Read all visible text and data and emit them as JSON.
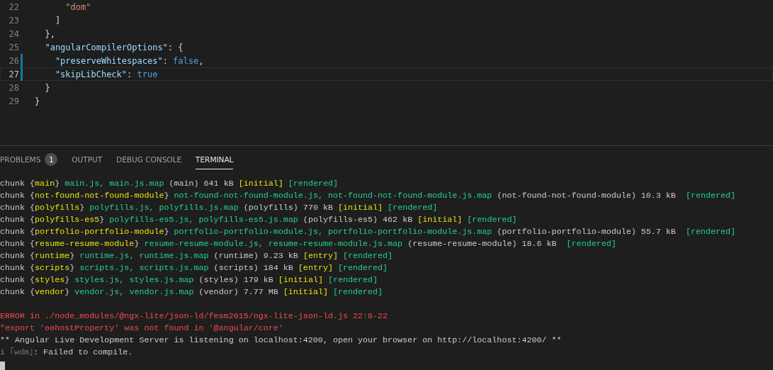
{
  "editor": {
    "lines": [
      {
        "number": "22",
        "current": false,
        "modified": false,
        "tokens": [
          {
            "kind": "string",
            "text": "      \"dom\""
          }
        ]
      },
      {
        "number": "23",
        "current": false,
        "modified": false,
        "tokens": [
          {
            "kind": "punct",
            "text": "    ]"
          }
        ]
      },
      {
        "number": "24",
        "current": false,
        "modified": false,
        "tokens": [
          {
            "kind": "punct",
            "text": "  },"
          }
        ]
      },
      {
        "number": "25",
        "current": false,
        "modified": false,
        "tokens": [
          {
            "kind": "key",
            "text": "  \"angularCompilerOptions\""
          },
          {
            "kind": "punct",
            "text": ": {"
          }
        ]
      },
      {
        "number": "26",
        "current": false,
        "modified": true,
        "tokens": [
          {
            "kind": "key",
            "text": "    \"preserveWhitespaces\""
          },
          {
            "kind": "punct",
            "text": ": "
          },
          {
            "kind": "keyword",
            "text": "false"
          },
          {
            "kind": "punct",
            "text": ","
          }
        ]
      },
      {
        "number": "27",
        "current": true,
        "modified": true,
        "tokens": [
          {
            "kind": "key",
            "text": "    \"skipLibCheck\""
          },
          {
            "kind": "punct",
            "text": ": "
          },
          {
            "kind": "keyword",
            "text": "true"
          }
        ]
      },
      {
        "number": "28",
        "current": false,
        "modified": false,
        "tokens": [
          {
            "kind": "punct",
            "text": "  }"
          }
        ]
      },
      {
        "number": "29",
        "current": false,
        "modified": false,
        "tokens": [
          {
            "kind": "punct",
            "text": "}"
          }
        ]
      }
    ]
  },
  "panel": {
    "tabs": [
      {
        "label": "PROBLEMS",
        "badge": "1",
        "selected": false
      },
      {
        "label": "OUTPUT",
        "selected": false
      },
      {
        "label": "DEBUG CONSOLE",
        "selected": false
      },
      {
        "label": "TERMINAL",
        "selected": true
      }
    ],
    "terminal": {
      "blocks": [
        {
          "lines": [
            [
              {
                "kind": "text",
                "text": "chunk "
              },
              {
                "kind": "text",
                "text": "{"
              },
              {
                "kind": "name",
                "text": "main"
              },
              {
                "kind": "text",
                "text": "}"
              },
              {
                "kind": "file",
                "text": " main.js, main.js.map"
              },
              {
                "kind": "text",
                "text": " (main) 641 kB "
              },
              {
                "kind": "name",
                "text": "[initial]"
              },
              {
                "kind": "file",
                "text": " [rendered]"
              }
            ],
            [
              {
                "kind": "text",
                "text": "chunk "
              },
              {
                "kind": "text",
                "text": "{"
              },
              {
                "kind": "name",
                "text": "not-found-not-found-module"
              },
              {
                "kind": "text",
                "text": "}"
              },
              {
                "kind": "file",
                "text": " not-found-not-found-module.js, not-found-not-found-module.js.map"
              },
              {
                "kind": "text",
                "text": " (not-found-not-found-module) 10.3 kB  "
              },
              {
                "kind": "file",
                "text": "[rendered]"
              }
            ],
            [
              {
                "kind": "text",
                "text": "chunk "
              },
              {
                "kind": "text",
                "text": "{"
              },
              {
                "kind": "name",
                "text": "polyfills"
              },
              {
                "kind": "text",
                "text": "}"
              },
              {
                "kind": "file",
                "text": " polyfills.js, polyfills.js.map"
              },
              {
                "kind": "text",
                "text": " (polyfills) 770 kB "
              },
              {
                "kind": "name",
                "text": "[initial]"
              },
              {
                "kind": "file",
                "text": " [rendered]"
              }
            ],
            [
              {
                "kind": "text",
                "text": "chunk "
              },
              {
                "kind": "text",
                "text": "{"
              },
              {
                "kind": "name",
                "text": "polyfills-es5"
              },
              {
                "kind": "text",
                "text": "}"
              },
              {
                "kind": "file",
                "text": " polyfills-es5.js, polyfills-es5.js.map"
              },
              {
                "kind": "text",
                "text": " (polyfills-es5) 462 kB "
              },
              {
                "kind": "name",
                "text": "[initial]"
              },
              {
                "kind": "file",
                "text": " [rendered]"
              }
            ],
            [
              {
                "kind": "text",
                "text": "chunk "
              },
              {
                "kind": "text",
                "text": "{"
              },
              {
                "kind": "name",
                "text": "portfolio-portfolio-module"
              },
              {
                "kind": "text",
                "text": "}"
              },
              {
                "kind": "file",
                "text": " portfolio-portfolio-module.js, portfolio-portfolio-module.js.map"
              },
              {
                "kind": "text",
                "text": " (portfolio-portfolio-module) 55.7 kB  "
              },
              {
                "kind": "file",
                "text": "[rendered]"
              }
            ],
            [
              {
                "kind": "text",
                "text": "chunk "
              },
              {
                "kind": "text",
                "text": "{"
              },
              {
                "kind": "name",
                "text": "resume-resume-module"
              },
              {
                "kind": "text",
                "text": "}"
              },
              {
                "kind": "file",
                "text": " resume-resume-module.js, resume-resume-module.js.map"
              },
              {
                "kind": "text",
                "text": " (resume-resume-module) 18.6 kB  "
              },
              {
                "kind": "file",
                "text": "[rendered]"
              }
            ],
            [
              {
                "kind": "text",
                "text": "chunk "
              },
              {
                "kind": "text",
                "text": "{"
              },
              {
                "kind": "name",
                "text": "runtime"
              },
              {
                "kind": "text",
                "text": "}"
              },
              {
                "kind": "file",
                "text": " runtime.js, runtime.js.map"
              },
              {
                "kind": "text",
                "text": " (runtime) 9.23 kB "
              },
              {
                "kind": "name",
                "text": "[entry]"
              },
              {
                "kind": "file",
                "text": " [rendered]"
              }
            ],
            [
              {
                "kind": "text",
                "text": "chunk "
              },
              {
                "kind": "text",
                "text": "{"
              },
              {
                "kind": "name",
                "text": "scripts"
              },
              {
                "kind": "text",
                "text": "}"
              },
              {
                "kind": "file",
                "text": " scripts.js, scripts.js.map"
              },
              {
                "kind": "text",
                "text": " (scripts) 184 kB "
              },
              {
                "kind": "name",
                "text": "[entry]"
              },
              {
                "kind": "file",
                "text": " [rendered]"
              }
            ],
            [
              {
                "kind": "text",
                "text": "chunk "
              },
              {
                "kind": "text",
                "text": "{"
              },
              {
                "kind": "name",
                "text": "styles"
              },
              {
                "kind": "text",
                "text": "}"
              },
              {
                "kind": "file",
                "text": " styles.js, styles.js.map"
              },
              {
                "kind": "text",
                "text": " (styles) 179 kB "
              },
              {
                "kind": "name",
                "text": "[initial]"
              },
              {
                "kind": "file",
                "text": " [rendered]"
              }
            ],
            [
              {
                "kind": "text",
                "text": "chunk "
              },
              {
                "kind": "text",
                "text": "{"
              },
              {
                "kind": "name",
                "text": "vendor"
              },
              {
                "kind": "text",
                "text": "}"
              },
              {
                "kind": "file",
                "text": " vendor.js, vendor.js.map"
              },
              {
                "kind": "text",
                "text": " (vendor) 7.77 MB "
              },
              {
                "kind": "name",
                "text": "[initial]"
              },
              {
                "kind": "file",
                "text": " [rendered]"
              }
            ]
          ]
        },
        {
          "lines": [
            [
              {
                "kind": "error",
                "text": "ERROR in ./node_modules/@ngx-lite/json-ld/fesm2015/ngx-lite-json-ld.js 22:8-22"
              }
            ],
            [
              {
                "kind": "error",
                "text": "\"export 'ɵɵhostProperty' was not found in '@angular/core'"
              }
            ],
            [
              {
                "kind": "text",
                "text": "** Angular Live Development Server is listening on localhost:4200, open your browser on http://localhost:4200/ **"
              }
            ],
            [
              {
                "kind": "info",
                "text": "i"
              },
              {
                "kind": "dim",
                "text": " ｢wdm｣"
              },
              {
                "kind": "text",
                "text": ": Failed to compile."
              }
            ]
          ]
        }
      ]
    }
  }
}
